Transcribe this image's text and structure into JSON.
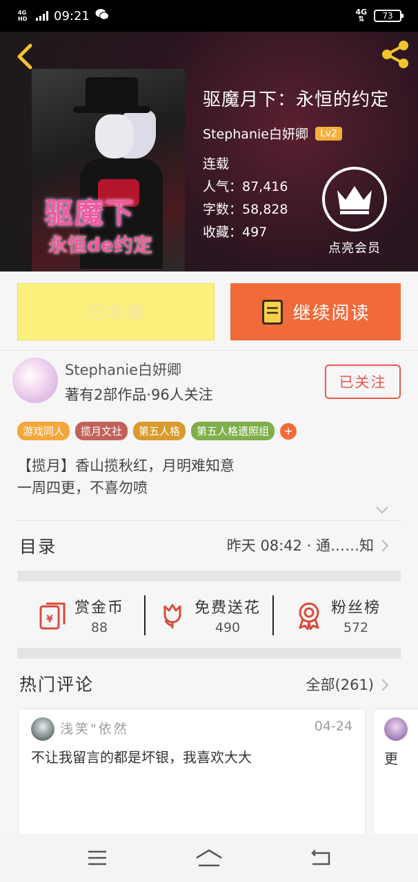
{
  "status_bar": {
    "network": "4G HD",
    "time": "09:21",
    "right_network": "4G",
    "battery": "73"
  },
  "book": {
    "title": "驱魔月下：永恒的约定",
    "author": "Stephanie白妍卿",
    "level": "Lv2",
    "status": "连载",
    "popularity": "人气：87,416",
    "word_count": "字数：58,828",
    "collections": "收藏：497",
    "cover_title": "驱魔下",
    "cover_subtitle": "永恒de约定"
  },
  "vip": {
    "label": "点亮会员"
  },
  "actions": {
    "collected_label": "已收藏",
    "read_label": "继续阅读"
  },
  "author_card": {
    "name": "Stephanie白妍卿",
    "meta": "著有2部作品·96人关注",
    "follow_label": "已关注"
  },
  "tags": [
    {
      "label": "游戏同人",
      "color": "#f3a83a"
    },
    {
      "label": "揽月文社",
      "color": "#c0625a"
    },
    {
      "label": "第五人格",
      "color": "#d99a2e"
    },
    {
      "label": "第五人格遗照组",
      "color": "#7fae4a"
    }
  ],
  "tag_more": "+",
  "intro": {
    "line1": "【揽月】香山揽秋红，月明难知意",
    "line2": "一周四更，不喜勿喷"
  },
  "toc": {
    "title": "目录",
    "update": "昨天 08:42 · 通……知"
  },
  "rewards": [
    {
      "label": "赏金币",
      "count": "88"
    },
    {
      "label": "免费送花",
      "count": "490"
    },
    {
      "label": "粉丝榜",
      "count": "572"
    }
  ],
  "hot_comments": {
    "title": "热门评论",
    "all_label": "全部(261)"
  },
  "comments": [
    {
      "user": "浅笑\"依然",
      "date": "04-24",
      "text": "不让我留言的都是坏银，我喜欢大大"
    },
    {
      "text": "更"
    }
  ],
  "colors": {
    "accent_orange": "#f06a3a",
    "collected_yellow": "#fbf07c",
    "follow_red": "#e85a4a",
    "lv_badge": "#f3b13c"
  }
}
